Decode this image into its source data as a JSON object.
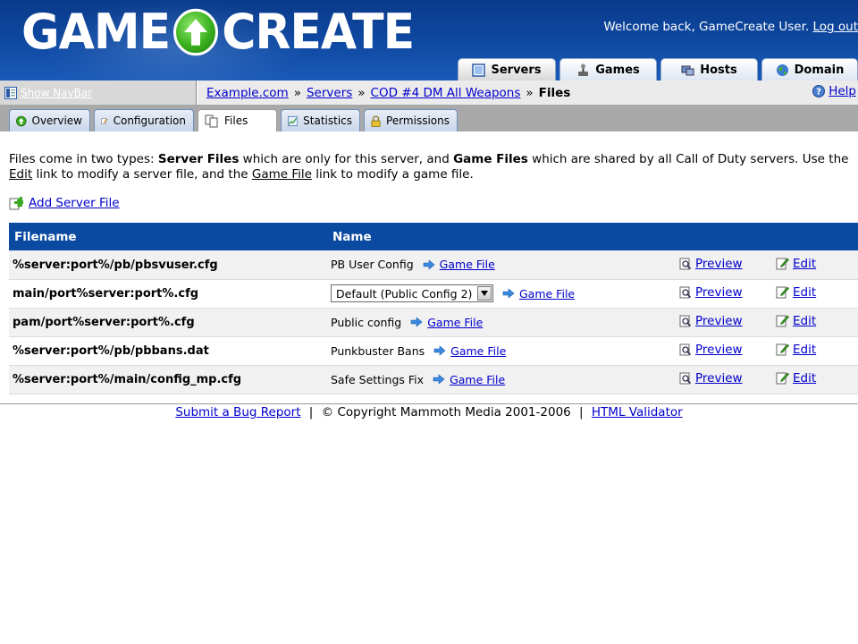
{
  "header": {
    "logo_left": "GAME",
    "logo_right": "CREATE",
    "welcome": "Welcome back, GameCreate User.",
    "logout": "Log out"
  },
  "top_tabs": [
    {
      "label": "Servers",
      "icon": "server-icon",
      "active": true
    },
    {
      "label": "Games",
      "icon": "joystick-icon",
      "active": false
    },
    {
      "label": "Hosts",
      "icon": "host-icon",
      "active": false
    },
    {
      "label": "Domain",
      "icon": "globe-icon",
      "active": false
    }
  ],
  "navbar": {
    "show_label": "Show NavBar"
  },
  "breadcrumb": {
    "items": [
      "Example.com",
      "Servers",
      "COD #4 DM All Weapons"
    ],
    "separator": "»",
    "current": "Files"
  },
  "help": {
    "label": "Help"
  },
  "sub_tabs": [
    {
      "label": "Overview",
      "icon": "arrow-up-icon",
      "active": false
    },
    {
      "label": "Configuration",
      "icon": "pencil-icon",
      "active": false
    },
    {
      "label": "Files",
      "icon": "files-icon",
      "active": true
    },
    {
      "label": "Statistics",
      "icon": "chart-icon",
      "active": false
    },
    {
      "label": "Permissions",
      "icon": "lock-icon",
      "active": false
    }
  ],
  "intro": {
    "p1": "Files come in two types: ",
    "server_files": "Server Files",
    "p2": " which are only for this server, and ",
    "game_files": "Game Files",
    "p3": " which are shared by all Call of Duty servers. Use the ",
    "edit": "Edit",
    "p4": " link to modify a server file, and the ",
    "game_file": "Game File",
    "p5": " link to modify a game file."
  },
  "add_file": {
    "label": "Add Server File"
  },
  "table": {
    "headers": {
      "filename": "Filename",
      "name": "Name"
    },
    "rows": [
      {
        "filename": "%server:port%/pb/pbsvuser.cfg",
        "name": "PB User Config",
        "game_file": "Game File",
        "preview": "Preview",
        "edit": "Edit",
        "select": null
      },
      {
        "filename": "main/port%server:port%.cfg",
        "name": "",
        "game_file": "Game File",
        "preview": "Preview",
        "edit": "Edit",
        "select": "Default (Public Config 2)"
      },
      {
        "filename": "pam/port%server:port%.cfg",
        "name": "Public config",
        "game_file": "Game File",
        "preview": "Preview",
        "edit": "Edit",
        "select": null
      },
      {
        "filename": "%server:port%/pb/pbbans.dat",
        "name": "Punkbuster Bans",
        "game_file": "Game File",
        "preview": "Preview",
        "edit": "Edit",
        "select": null
      },
      {
        "filename": "%server:port%/main/config_mp.cfg",
        "name": "Safe Settings Fix",
        "game_file": "Game File",
        "preview": "Preview",
        "edit": "Edit",
        "select": null
      }
    ]
  },
  "footer": {
    "bug_report": "Submit a Bug Report",
    "pipe": "|",
    "copyright": "© Copyright Mammoth Media 2001-2006",
    "validator": "HTML Validator"
  },
  "colors": {
    "header_blue": "#0f4aa3",
    "table_header": "#0a4aa0",
    "link": "#0000cc"
  }
}
